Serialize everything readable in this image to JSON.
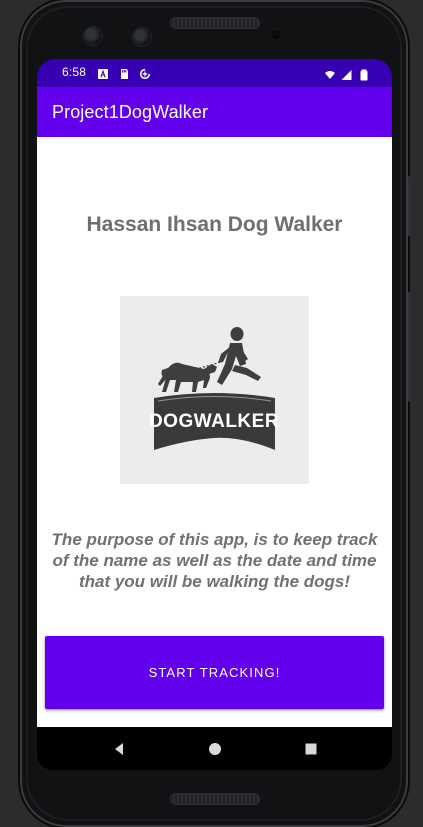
{
  "status_bar": {
    "time": "6:58",
    "icons_left": [
      "a-icon",
      "sd-card-icon",
      "data-saver-icon"
    ],
    "icons_right": [
      "wifi-icon",
      "signal-icon",
      "battery-icon"
    ]
  },
  "app_bar": {
    "title": "Project1DogWalker"
  },
  "main": {
    "title": "Hassan Ihsan Dog Walker",
    "logo_text": "DOGWALKER",
    "description": "The purpose of this app, is to keep track of the name as well as the date and time that you will be walking the dogs!",
    "button_label": "START TRACKING!"
  },
  "nav": {
    "items": [
      "back-icon",
      "home-icon",
      "recents-icon"
    ]
  },
  "colors": {
    "status_bar": "#3700b3",
    "primary": "#6200ee",
    "text_gray": "#6f6f6f",
    "logo_bg": "#ececec"
  }
}
